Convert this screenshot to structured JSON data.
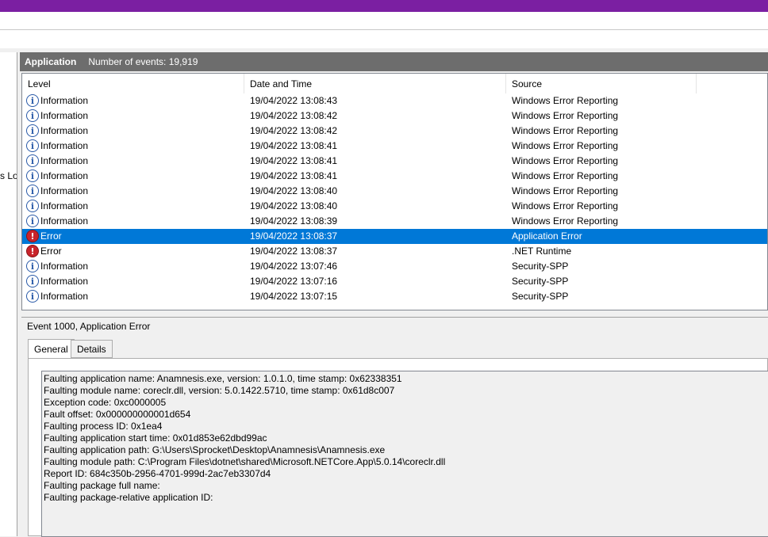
{
  "left_pane": {
    "truncated_label": "s Lo"
  },
  "pane": {
    "title": "Application",
    "event_count": "Number of events: 19,919"
  },
  "columns": {
    "level": "Level",
    "date_time": "Date and Time",
    "source": "Source"
  },
  "events": [
    {
      "level": "Information",
      "icon": "info-icon",
      "date": "19/04/2022 13:08:43",
      "source": "Windows Error Reporting"
    },
    {
      "level": "Information",
      "icon": "info-icon",
      "date": "19/04/2022 13:08:42",
      "source": "Windows Error Reporting"
    },
    {
      "level": "Information",
      "icon": "info-icon",
      "date": "19/04/2022 13:08:42",
      "source": "Windows Error Reporting"
    },
    {
      "level": "Information",
      "icon": "info-icon",
      "date": "19/04/2022 13:08:41",
      "source": "Windows Error Reporting"
    },
    {
      "level": "Information",
      "icon": "info-icon",
      "date": "19/04/2022 13:08:41",
      "source": "Windows Error Reporting"
    },
    {
      "level": "Information",
      "icon": "info-icon",
      "date": "19/04/2022 13:08:41",
      "source": "Windows Error Reporting"
    },
    {
      "level": "Information",
      "icon": "info-icon",
      "date": "19/04/2022 13:08:40",
      "source": "Windows Error Reporting"
    },
    {
      "level": "Information",
      "icon": "info-icon",
      "date": "19/04/2022 13:08:40",
      "source": "Windows Error Reporting"
    },
    {
      "level": "Information",
      "icon": "info-icon",
      "date": "19/04/2022 13:08:39",
      "source": "Windows Error Reporting"
    },
    {
      "level": "Error",
      "icon": "error-icon",
      "date": "19/04/2022 13:08:37",
      "source": "Application Error"
    },
    {
      "level": "Error",
      "icon": "error-icon",
      "date": "19/04/2022 13:08:37",
      "source": ".NET Runtime"
    },
    {
      "level": "Information",
      "icon": "info-icon",
      "date": "19/04/2022 13:07:46",
      "source": "Security-SPP"
    },
    {
      "level": "Information",
      "icon": "info-icon",
      "date": "19/04/2022 13:07:16",
      "source": "Security-SPP"
    },
    {
      "level": "Information",
      "icon": "info-icon",
      "date": "19/04/2022 13:07:15",
      "source": "Security-SPP"
    }
  ],
  "selected_index": 9,
  "detail": {
    "header": "Event 1000, Application Error",
    "tabs": [
      "General",
      "Details"
    ],
    "lines": [
      "Faulting application name: Anamnesis.exe, version: 1.0.1.0, time stamp: 0x62338351",
      "Faulting module name: coreclr.dll, version: 5.0.1422.5710, time stamp: 0x61d8c007",
      "Exception code: 0xc0000005",
      "Fault offset: 0x000000000001d654",
      "Faulting process ID: 0x1ea4",
      "Faulting application start time: 0x01d853e62dbd99ac",
      "Faulting application path: G:\\Users\\Sprocket\\Desktop\\Anamnesis\\Anamnesis.exe",
      "Faulting module path: C:\\Program Files\\dotnet\\shared\\Microsoft.NETCore.App\\5.0.14\\coreclr.dll",
      "Report ID: 684c350b-2956-4701-999d-2ac7eb3307d4",
      "Faulting package full name: ",
      "Faulting package-relative application ID: "
    ]
  },
  "colors": {
    "title_bar": "#7b1fa2",
    "selection": "#0078d7",
    "pane_header": "#6d6d6d",
    "error_icon": "#c9242b",
    "info_icon": "#2a5aa8"
  }
}
